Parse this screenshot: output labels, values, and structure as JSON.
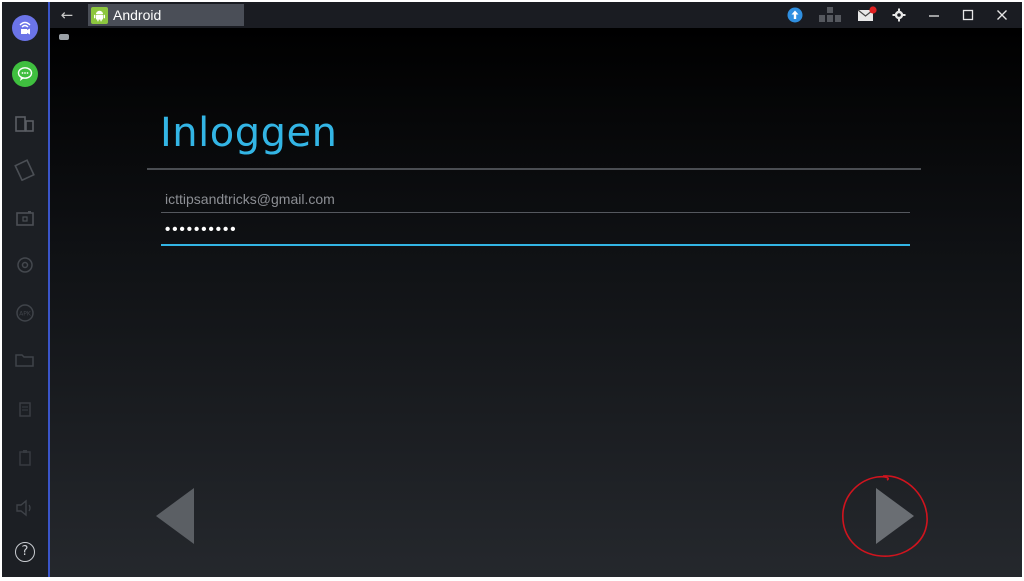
{
  "window": {
    "app_title": "Android",
    "back_glyph": "←"
  },
  "titlebar_icons": [
    "upload-icon",
    "keyboard-icon",
    "notification-icon",
    "gear-icon",
    "minimize-icon",
    "maximize-icon",
    "close-icon"
  ],
  "sidebar": {
    "items": [
      "video-call-icon",
      "chat-icon",
      "device-icon",
      "rotate-icon",
      "camera-icon",
      "location-icon",
      "apk-icon",
      "folder-icon",
      "copy-icon",
      "paste-icon",
      "volume-icon",
      "help-icon"
    ],
    "help_glyph": "?"
  },
  "login": {
    "title": "Inloggen",
    "email_value": "icttipsandtricks@gmail.com",
    "password_value": "••••••••••"
  },
  "colors": {
    "accent": "#33b5e5",
    "android_green": "#8cc63e",
    "sidebar_video": "#6b74e8",
    "sidebar_chat": "#3fbf3f",
    "annotation_red": "#d0141e"
  }
}
